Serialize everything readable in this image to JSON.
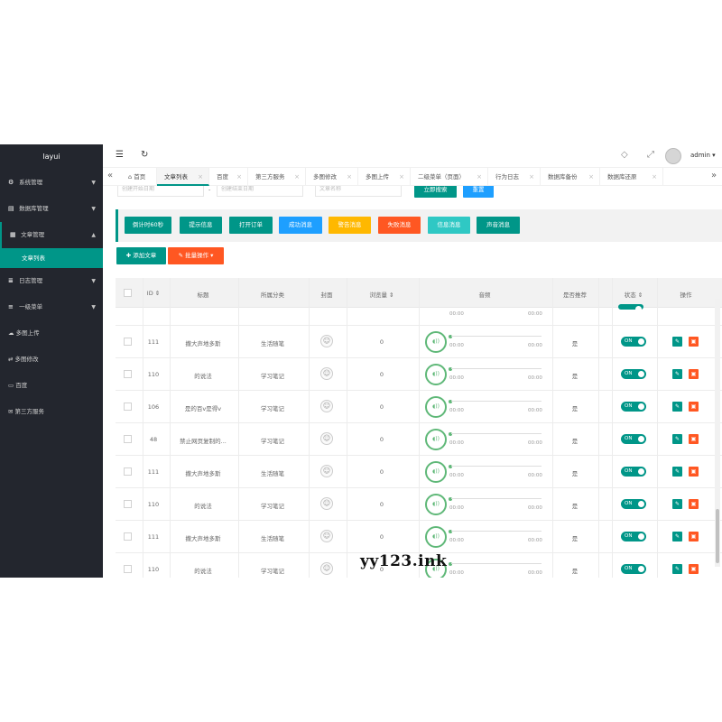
{
  "sidebar": {
    "logo": "layui",
    "items": [
      {
        "label": "系统管理",
        "icon": "gear-icon",
        "glyph": "⚙"
      },
      {
        "label": "数据库管理",
        "icon": "database-icon",
        "glyph": "▤"
      },
      {
        "label": "文章管理",
        "icon": "article-icon",
        "glyph": "▦"
      },
      {
        "label": "日志管理",
        "icon": "log-icon",
        "glyph": "≣"
      },
      {
        "label": "一级菜单",
        "icon": "menu-icon",
        "glyph": "≡"
      }
    ],
    "active_sub": "文章列表",
    "plain_items": [
      {
        "label": "多图上传",
        "icon": "cloud-upload-icon",
        "glyph": "☁"
      },
      {
        "label": "多图修改",
        "icon": "transfer-icon",
        "glyph": "⇄"
      },
      {
        "label": "百度",
        "icon": "window-icon",
        "glyph": "▭"
      },
      {
        "label": "第三方服务",
        "icon": "mail-icon",
        "glyph": "✉"
      }
    ]
  },
  "header": {
    "user": "admin",
    "menu_glyph": "☰",
    "refresh_glyph": "↻",
    "tag_glyph": "◇",
    "fullscreen_glyph": "⤢",
    "user_caret": "▾"
  },
  "tabs": {
    "home": "首页",
    "items": [
      "文章列表",
      "百度",
      "第三方服务",
      "多图修改",
      "多图上传",
      "二级菜单（页面）",
      "行为日志",
      "数据库备份",
      "数据库还原"
    ],
    "left_arrow": "«",
    "right_arrow": "»",
    "close": "×"
  },
  "search": {
    "start_date": "创建开始日期",
    "end_date": "创建结束日期",
    "dash": "-",
    "title": "文章名称",
    "search_btn": "立即搜索",
    "reset_btn": "重置"
  },
  "toolbar": {
    "buttons": [
      "倒计时60秒",
      "提示信息",
      "打开订单",
      "成功消息",
      "警告消息",
      "失败消息",
      "信息消息",
      "声音消息"
    ],
    "add": "✚ 添加文章",
    "batch": "✎ 批量操作 ▾"
  },
  "table": {
    "headers": [
      "ID ⇕",
      "标题",
      "所属分类",
      "封面",
      "浏览量 ⇕",
      "音频",
      "是否推荐",
      "状态 ⇕",
      "操作"
    ],
    "rows": [
      {
        "id": "111",
        "title": "撒大声地多斯",
        "category": "生活随笔",
        "views": "0",
        "t1": "00:00",
        "t2": "00:00",
        "recommend": "是",
        "status": "ON"
      },
      {
        "id": "110",
        "title": "的说法",
        "category": "学习笔记",
        "views": "0",
        "t1": "00:00",
        "t2": "00:00",
        "recommend": "是",
        "status": "ON"
      },
      {
        "id": "106",
        "title": "是的百v是得v",
        "category": "学习笔记",
        "views": "0",
        "t1": "00:00",
        "t2": "00:00",
        "recommend": "是",
        "status": "ON"
      },
      {
        "id": "48",
        "title": "禁止网页复制的...",
        "category": "学习笔记",
        "views": "0",
        "t1": "00:00",
        "t2": "00:00",
        "recommend": "是",
        "status": "ON"
      },
      {
        "id": "111",
        "title": "撒大声地多斯",
        "category": "生活随笔",
        "views": "0",
        "t1": "00:00",
        "t2": "00:00",
        "recommend": "是",
        "status": "ON"
      },
      {
        "id": "110",
        "title": "的说法",
        "category": "学习笔记",
        "views": "0",
        "t1": "00:00",
        "t2": "00:00",
        "recommend": "是",
        "status": "ON"
      },
      {
        "id": "111",
        "title": "撒大声地多斯",
        "category": "生活随笔",
        "views": "0",
        "t1": "00:00",
        "t2": "00:00",
        "recommend": "是",
        "status": "ON"
      },
      {
        "id": "110",
        "title": "的说法",
        "category": "学习笔记",
        "views": "0",
        "t1": "00:00",
        "t2": "00:00",
        "recommend": "是",
        "status": "ON"
      }
    ],
    "partial_row": {
      "t1": "00:00",
      "t2": "00:00"
    }
  },
  "watermark": "yy123.ink",
  "colors": {
    "primary": "#009688",
    "blue": "#1e9fff",
    "orange": "#ffb800",
    "red": "#ff5722",
    "cyan": "#2fc8c4",
    "sidebar": "#23262e"
  }
}
